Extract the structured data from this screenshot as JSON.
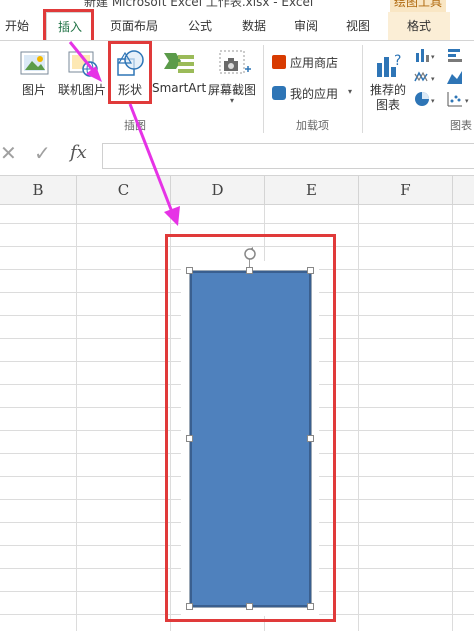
{
  "window": {
    "title": "新建 Microsoft Excel 工作表.xlsx - Excel",
    "context_tab_group": "绘图工具"
  },
  "tabs": [
    {
      "label": "开始",
      "active": false
    },
    {
      "label": "插入",
      "active": true
    },
    {
      "label": "页面布局",
      "active": false
    },
    {
      "label": "公式",
      "active": false
    },
    {
      "label": "数据",
      "active": false
    },
    {
      "label": "审阅",
      "active": false
    },
    {
      "label": "视图",
      "active": false
    },
    {
      "label": "格式",
      "active": false
    }
  ],
  "ribbon": {
    "illustrations": {
      "picture": "图片",
      "online_picture": "联机图片",
      "shapes": "形状",
      "smartart": "SmartArt",
      "screenshot": "屏幕截图",
      "group_label": "插图"
    },
    "addins": {
      "app_store": "应用商店",
      "my_apps": "我的应用",
      "group_label": "加载项"
    },
    "charts": {
      "recommended_line1": "推荐的",
      "recommended_line2": "图表",
      "group_label": "图表"
    }
  },
  "formula_bar": {
    "cancel": "✕",
    "enter": "✓",
    "fx": "fx",
    "value": ""
  },
  "columns": [
    "B",
    "C",
    "D",
    "E",
    "F"
  ],
  "colors": {
    "shape_fill": "#4f81bd",
    "shape_border": "#3a5f8f",
    "highlight": "#e03a3a",
    "arrow": "#e633e6",
    "active_tab_text": "#217346"
  }
}
